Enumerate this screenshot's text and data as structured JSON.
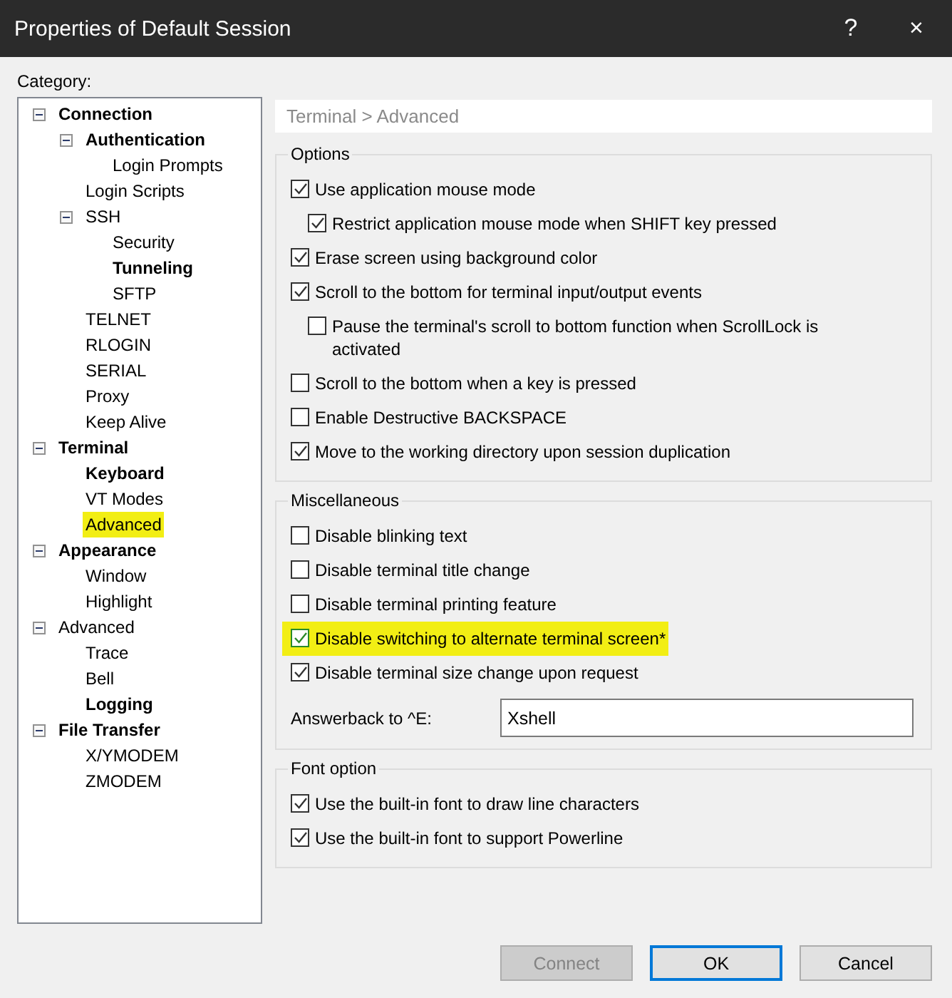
{
  "window": {
    "title": "Properties of Default Session",
    "help": "?",
    "close": "×"
  },
  "category_label": "Category:",
  "tree": [
    {
      "label": "Connection",
      "bold": true,
      "expanded": true,
      "selected": false,
      "children": [
        {
          "label": "Authentication",
          "bold": true,
          "expanded": true,
          "selected": false,
          "children": [
            {
              "label": "Login Prompts",
              "bold": false,
              "selected": false
            }
          ]
        },
        {
          "label": "Login Scripts",
          "bold": false,
          "selected": false
        },
        {
          "label": "SSH",
          "bold": false,
          "expanded": true,
          "selected": false,
          "children": [
            {
              "label": "Security",
              "bold": false,
              "selected": false
            },
            {
              "label": "Tunneling",
              "bold": true,
              "selected": false
            },
            {
              "label": "SFTP",
              "bold": false,
              "selected": false
            }
          ]
        },
        {
          "label": "TELNET",
          "bold": false,
          "selected": false
        },
        {
          "label": "RLOGIN",
          "bold": false,
          "selected": false
        },
        {
          "label": "SERIAL",
          "bold": false,
          "selected": false
        },
        {
          "label": "Proxy",
          "bold": false,
          "selected": false
        },
        {
          "label": "Keep Alive",
          "bold": false,
          "selected": false
        }
      ]
    },
    {
      "label": "Terminal",
      "bold": true,
      "expanded": true,
      "selected": false,
      "children": [
        {
          "label": "Keyboard",
          "bold": true,
          "selected": false
        },
        {
          "label": "VT Modes",
          "bold": false,
          "selected": false
        },
        {
          "label": "Advanced",
          "bold": false,
          "selected": true
        }
      ]
    },
    {
      "label": "Appearance",
      "bold": true,
      "expanded": true,
      "selected": false,
      "children": [
        {
          "label": "Window",
          "bold": false,
          "selected": false
        },
        {
          "label": "Highlight",
          "bold": false,
          "selected": false
        }
      ]
    },
    {
      "label": "Advanced",
      "bold": false,
      "expanded": true,
      "selected": false,
      "children": [
        {
          "label": "Trace",
          "bold": false,
          "selected": false
        },
        {
          "label": "Bell",
          "bold": false,
          "selected": false
        },
        {
          "label": "Logging",
          "bold": true,
          "selected": false
        }
      ]
    },
    {
      "label": "File Transfer",
      "bold": true,
      "expanded": true,
      "selected": false,
      "children": [
        {
          "label": "X/YMODEM",
          "bold": false,
          "selected": false
        },
        {
          "label": "ZMODEM",
          "bold": false,
          "selected": false
        }
      ]
    }
  ],
  "breadcrumb": "Terminal > Advanced",
  "groups": [
    {
      "title": "Options",
      "options": [
        {
          "label": "Use application mouse mode",
          "checked": true,
          "highlighted": false,
          "children": [
            {
              "label": "Restrict application mouse mode when SHIFT key pressed",
              "checked": true,
              "highlighted": false
            }
          ]
        },
        {
          "label": "Erase screen using background color",
          "checked": true,
          "highlighted": false
        },
        {
          "label": "Scroll to the bottom for terminal input/output events",
          "checked": true,
          "highlighted": false,
          "children": [
            {
              "label": "Pause the terminal's scroll to bottom function when ScrollLock is activated",
              "checked": false,
              "highlighted": false
            }
          ]
        },
        {
          "label": "Scroll to the bottom when a key is pressed",
          "checked": false,
          "highlighted": false
        },
        {
          "label": "Enable Destructive BACKSPACE",
          "checked": false,
          "highlighted": false
        },
        {
          "label": "Move to the working directory upon session duplication",
          "checked": true,
          "highlighted": false
        }
      ]
    },
    {
      "title": "Miscellaneous",
      "options": [
        {
          "label": "Disable blinking text",
          "checked": false,
          "highlighted": false
        },
        {
          "label": "Disable terminal title change",
          "checked": false,
          "highlighted": false
        },
        {
          "label": "Disable terminal printing feature",
          "checked": false,
          "highlighted": false
        },
        {
          "label": "Disable switching to alternate terminal screen*",
          "checked": true,
          "highlighted": true
        },
        {
          "label": "Disable terminal size change upon request",
          "checked": true,
          "highlighted": false
        }
      ],
      "field": {
        "label": "Answerback to ^E:",
        "value": "Xshell"
      }
    },
    {
      "title": "Font option",
      "options": [
        {
          "label": "Use the built-in font to draw line characters",
          "checked": true,
          "highlighted": false
        },
        {
          "label": "Use the built-in font to support Powerline",
          "checked": true,
          "highlighted": false
        }
      ]
    }
  ],
  "buttons": [
    {
      "label": "Connect",
      "disabled": true,
      "default": false
    },
    {
      "label": "OK",
      "disabled": false,
      "default": true
    },
    {
      "label": "Cancel",
      "disabled": false,
      "default": false
    }
  ]
}
